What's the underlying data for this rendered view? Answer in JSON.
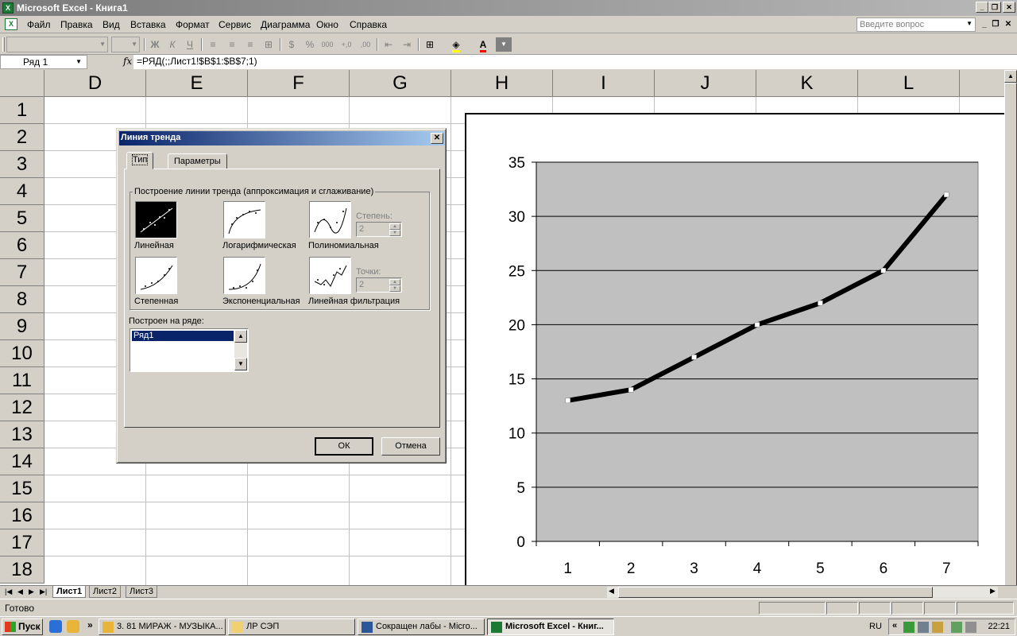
{
  "app": {
    "title": "Microsoft Excel - Книга1",
    "icon": "excel-icon"
  },
  "menu": {
    "items": [
      "Файл",
      "Правка",
      "Вид",
      "Вставка",
      "Формат",
      "Сервис",
      "Диаграмма",
      "Окно",
      "Справка"
    ],
    "question_placeholder": "Введите вопрос"
  },
  "formula_bar": {
    "name_box": "Ряд 1",
    "fx": "fx",
    "formula": "=РЯД(;;Лист1!$B$1:$B$7;1)"
  },
  "columns": [
    "D",
    "E",
    "F",
    "G",
    "H",
    "I",
    "J",
    "K",
    "L"
  ],
  "rows": [
    "1",
    "2",
    "3",
    "4",
    "5",
    "6",
    "7",
    "8",
    "9",
    "10",
    "11",
    "12",
    "13",
    "14",
    "15",
    "16",
    "17",
    "18"
  ],
  "sheets": {
    "tabs": [
      "Лист1",
      "Лист2",
      "Лист3"
    ],
    "active": "Лист1"
  },
  "status": {
    "text": "Готово"
  },
  "taskbar": {
    "start": "Пуск",
    "tasks": [
      "3. 81 МИРАЖ - МУЗЫКА...",
      "ЛР СЭП",
      "Сокращен лабы - Micro...",
      "Microsoft Excel - Книг..."
    ],
    "active_task": "Microsoft Excel - Книг...",
    "lang": "RU",
    "clock": "22:21"
  },
  "dialog": {
    "title": "Линия тренда",
    "close": "✕",
    "tabs": [
      "Тип",
      "Параметры"
    ],
    "group_label": "Построение линии тренда (аппроксимация и сглаживание)",
    "types": [
      "Линейная",
      "Логарифмическая",
      "Полиномиальная",
      "Степенная",
      "Экспоненциальная",
      "Линейная фильтрация"
    ],
    "selected_type": "Линейная",
    "degree_label": "Степень:",
    "degree_value": "2",
    "period_label": "Точки:",
    "period_value": "2",
    "series_label": "Построен на ряде:",
    "series": [
      "Ряд1"
    ],
    "ok": "ОК",
    "cancel": "Отмена"
  },
  "chart_data": {
    "type": "line",
    "title": "",
    "xlabel": "",
    "ylabel": "",
    "categories": [
      "1",
      "2",
      "3",
      "4",
      "5",
      "6",
      "7"
    ],
    "series": [
      {
        "values": [
          13,
          14,
          17,
          20,
          22,
          25,
          32
        ]
      }
    ],
    "ylim": [
      0,
      35
    ],
    "yticks": [
      "0",
      "5",
      "10",
      "15",
      "20",
      "25",
      "30",
      "35"
    ],
    "grid": true,
    "plot_bg": "#c0c0c0",
    "line_color": "#000000",
    "marker_color": "#ffffff"
  }
}
